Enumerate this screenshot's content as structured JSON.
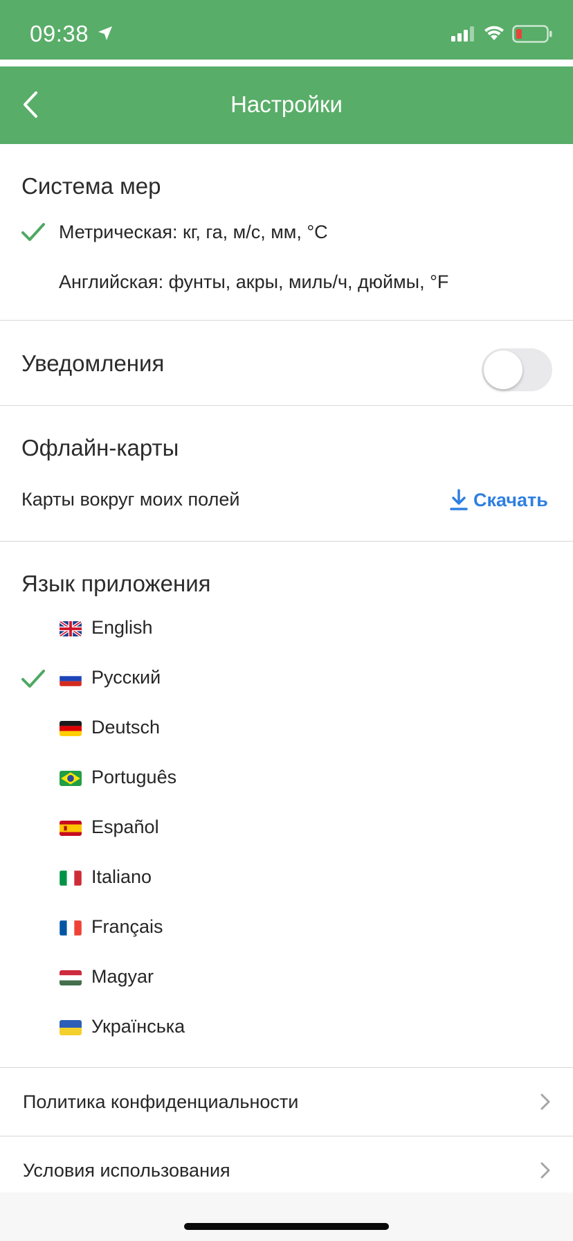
{
  "theme": {
    "accent": "#58ad68",
    "link": "#2f7fe0",
    "check_color": "#4fa863"
  },
  "status_bar": {
    "time": "09:38"
  },
  "header": {
    "title": "Настройки"
  },
  "measurement": {
    "title": "Система мер",
    "options": [
      {
        "label": "Метрическая: кг, га, м/с, мм, °C",
        "selected": true
      },
      {
        "label": "Английская: фунты, акры, миль/ч, дюймы, °F",
        "selected": false
      }
    ]
  },
  "notifications": {
    "label": "Уведомления",
    "enabled": false
  },
  "offline_maps": {
    "title": "Офлайн-карты",
    "row_label": "Карты вокруг моих полей",
    "download_label": "Скачать"
  },
  "language": {
    "title": "Язык приложения",
    "options": [
      {
        "label": "English",
        "flag": "uk",
        "selected": false
      },
      {
        "label": "Русский",
        "flag": "ru",
        "selected": true
      },
      {
        "label": "Deutsch",
        "flag": "de",
        "selected": false
      },
      {
        "label": "Português",
        "flag": "br",
        "selected": false
      },
      {
        "label": "Español",
        "flag": "es",
        "selected": false
      },
      {
        "label": "Italiano",
        "flag": "it",
        "selected": false
      },
      {
        "label": "Français",
        "flag": "fr",
        "selected": false
      },
      {
        "label": "Magyar",
        "flag": "hu",
        "selected": false
      },
      {
        "label": "Українська",
        "flag": "ua",
        "selected": false
      }
    ]
  },
  "links": {
    "privacy": "Политика конфиденциальности",
    "terms": "Условия использования"
  }
}
